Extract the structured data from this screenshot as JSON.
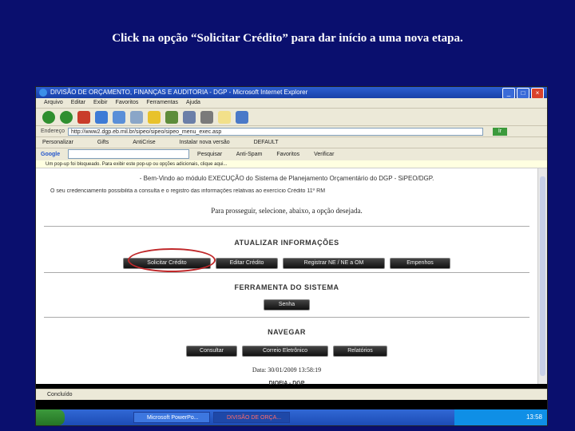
{
  "caption": "Click na opção “Solicitar Crédito” para dar início a uma nova etapa.",
  "browser": {
    "title": "DIVISÃO DE ORÇAMENTO, FINANÇAS E AUDITORIA - DGP - Microsoft Internet Explorer",
    "menu": [
      "Arquivo",
      "Editar",
      "Exibir",
      "Favoritos",
      "Ferramentas",
      "Ajuda"
    ],
    "address_label": "Endereço",
    "address_value": "http://www2.dgp.eb.mil.br/sipeo/sipeo/sipeo_menu_exec.asp",
    "go_label": "Ir",
    "links": [
      "Personalizar",
      "Gifts",
      "AntiCrise",
      "Instalar nova versão",
      "DEFAULT"
    ],
    "google_label": "Google",
    "google_items": [
      "Pesquisar",
      "Anti-Spam",
      "Favoritos",
      "Verificar"
    ],
    "infobar": "Um pop-up foi bloqueado. Para exibir este pop-up ou opções adicionais, clique aqui...",
    "status": "Concluído"
  },
  "page": {
    "welcome": "- Bem-Vindo ao módulo EXECUÇÃO do Sistema de Planejamento Orçamentário do DGP - SiPEO/DGP.",
    "notice": "O seu credenciamento possibilita a consulta e o registro das informações relativas ao exercício Crédito 11º RM",
    "instruction": "Para prosseguir, selecione, abaixo, a opção desejada.",
    "sections": [
      {
        "title": "ATUALIZAR INFORMAÇÕES",
        "buttons": [
          "Solicitar Crédito",
          "Editar Crédito",
          "Registrar NE / NE a OM",
          "Empenhos"
        ]
      },
      {
        "title": "FERRAMENTA DO SISTEMA",
        "buttons": [
          "Senha"
        ]
      },
      {
        "title": "NAVEGAR",
        "buttons": [
          "Consultar",
          "Correio Eletrônico",
          "Relatórios"
        ]
      }
    ],
    "date_line": "Data: 30/01/2009 13:58:19",
    "footer": "DIOFIA - DGP"
  },
  "taskbar": {
    "apps": [
      "Microsoft PowerPo...",
      "DIVISÃO DE ORÇA..."
    ],
    "clock": "13:58"
  }
}
